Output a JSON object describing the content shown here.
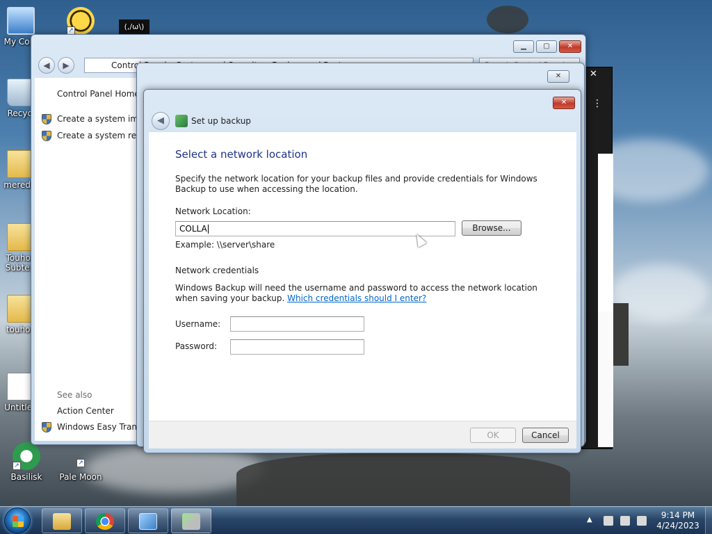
{
  "desktop": {
    "icons": [
      {
        "label": "My Com",
        "glyph": "computer-icon"
      },
      {
        "label": "Recycl",
        "glyph": "recycle-bin-icon"
      },
      {
        "label": "meredia",
        "glyph": "folder-icon"
      },
      {
        "label": "Touhou Subterr",
        "glyph": "folder-icon"
      },
      {
        "label": "touhou",
        "glyph": "folder-icon"
      },
      {
        "label": "Untitled",
        "glyph": "image-icon"
      },
      {
        "label": "Basilisk",
        "glyph": "basilisk-icon"
      },
      {
        "label": "Pale Moon",
        "glyph": "pale-moon-icon"
      },
      {
        "label": "",
        "glyph": "bee-icon"
      },
      {
        "label": "(,/ω\\)",
        "glyph": "black-window-icon"
      }
    ]
  },
  "control_panel": {
    "address": "Control Panel  ▸  System and Security  ▸  Backup and Restore",
    "search_placeholder": "Search Control Panel",
    "sidebar": {
      "home": "Control Panel Home",
      "links": [
        "Create a system image",
        "Create a system repair disc"
      ],
      "see_also_heading": "See also",
      "see_also": [
        "Action Center",
        "Windows Easy Transfer"
      ]
    }
  },
  "dialog": {
    "title": "Set up backup",
    "heading": "Select a network location",
    "intro": "Specify the network location for your backup files and provide credentials for Windows Backup to use when accessing the location.",
    "network_location_label": "Network Location:",
    "network_location_value": "COLLA",
    "browse_label": "Browse...",
    "example": "Example: \\\\server\\share",
    "credentials_heading": "Network credentials",
    "credentials_text": "Windows Backup will need the username and password to access the network location when saving your backup. ",
    "credentials_link": "Which credentials should I enter?",
    "username_label": "Username:",
    "username_value": "",
    "password_label": "Password:",
    "password_value": "",
    "ok_label": "OK",
    "cancel_label": "Cancel"
  },
  "taskbar": {
    "items": [
      "explorer-icon",
      "chrome-icon",
      "control-panel-icon",
      "backup-icon"
    ],
    "time": "9:14 PM",
    "date": "4/24/2023"
  },
  "colors": {
    "heading_blue": "#1e3287",
    "link_blue": "#0066cc",
    "close_red": "#c0392b"
  }
}
